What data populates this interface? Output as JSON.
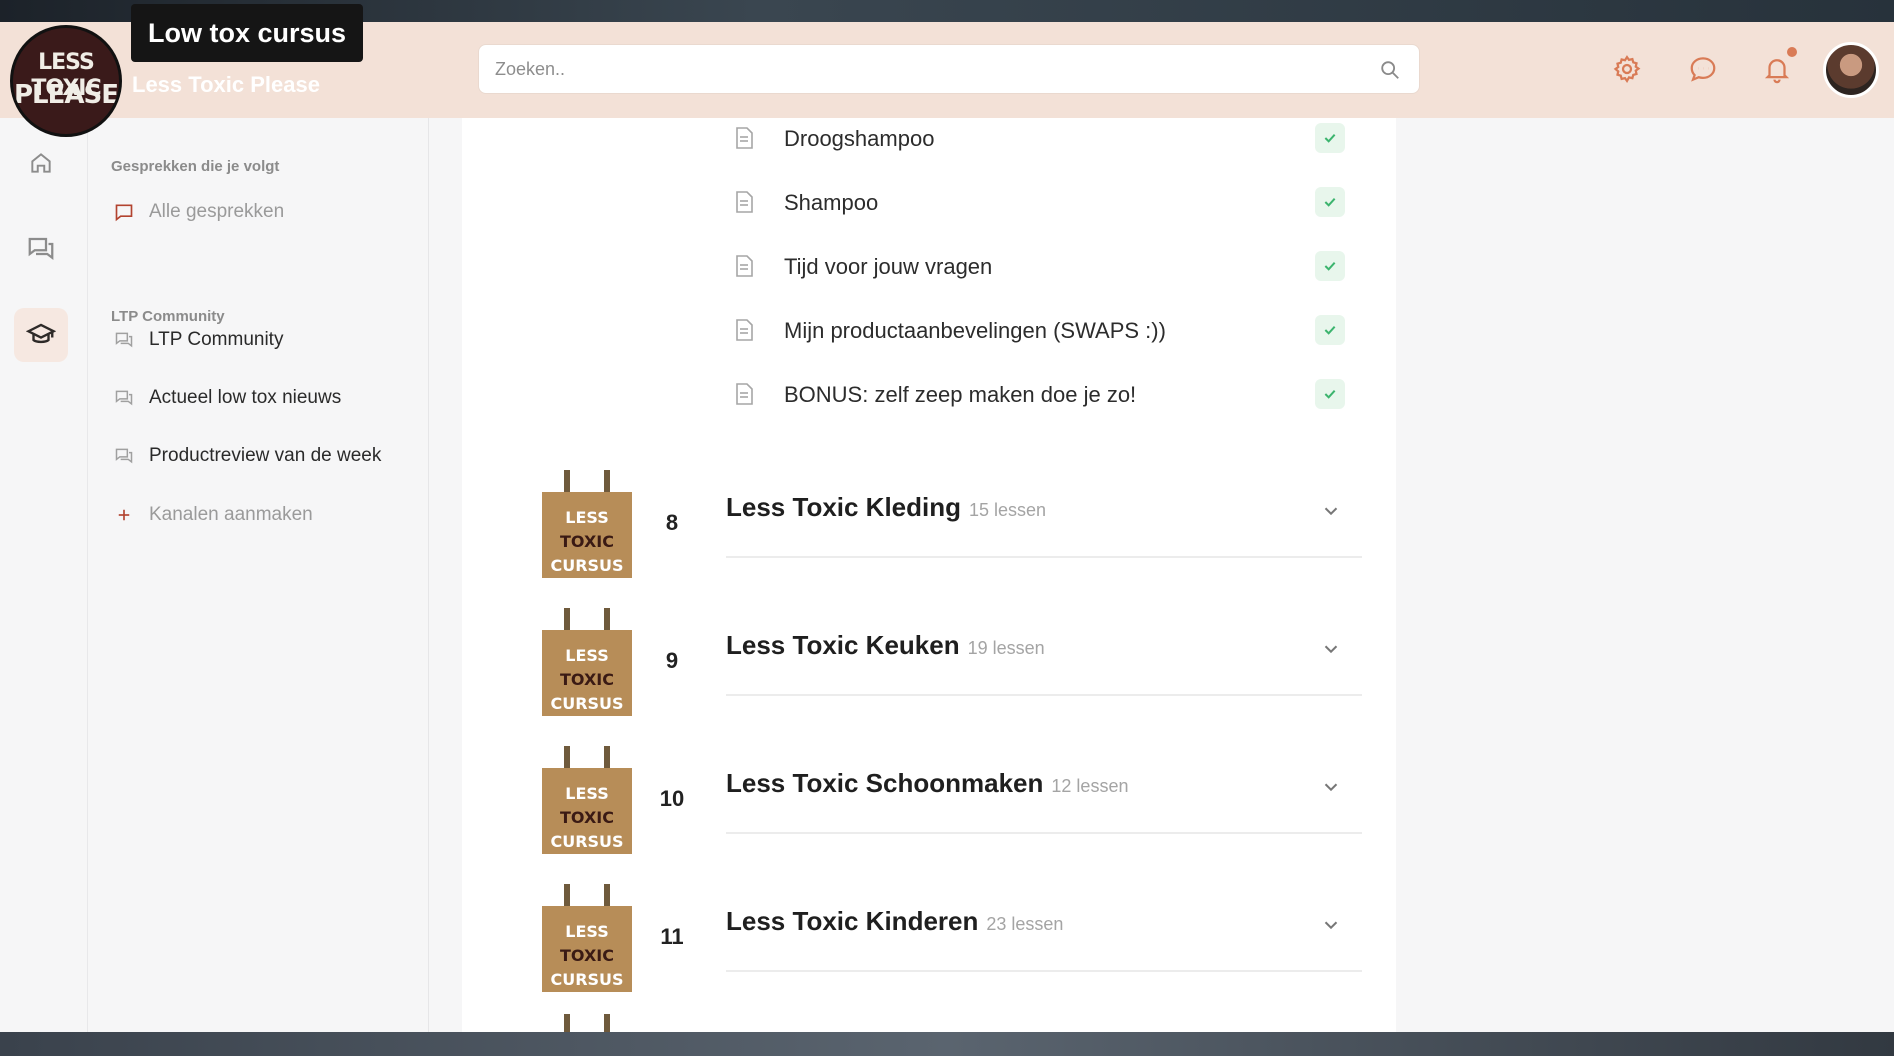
{
  "video": {
    "title": "Low tox cursus"
  },
  "brand": {
    "name": "Less Toxic Please",
    "logo_text_top": "LESS TOXIC",
    "logo_text_bottom": "PLEASE"
  },
  "search": {
    "placeholder": "Zoeken.."
  },
  "header_icons": [
    "gear-icon",
    "chat-bubble-icon",
    "bell-icon"
  ],
  "rail": [
    "home-icon",
    "forum-icon",
    "graduation-cap-icon"
  ],
  "sidebar": {
    "section_followed": "Gesprekken die je volgt",
    "all_conversations": "Alle gesprekken",
    "section_community": "LTP Community",
    "channels": [
      "LTP Community",
      "Actueel low tox nieuws",
      "Productreview van de week"
    ],
    "create_channel": "Kanalen aanmaken"
  },
  "lessons": [
    {
      "title": "Droogshampoo",
      "completed": true
    },
    {
      "title": "Shampoo",
      "completed": true
    },
    {
      "title": "Tijd voor jouw vragen",
      "completed": true
    },
    {
      "title": "Mijn productaanbevelingen (SWAPS :))",
      "completed": true
    },
    {
      "title": "BONUS: zelf zeep maken doe je zo!",
      "completed": true
    }
  ],
  "bag_label": {
    "line1": "LESS",
    "line2": "TOXIC",
    "line3": "CURSUS"
  },
  "modules": [
    {
      "number": "8",
      "title": "Less Toxic Kleding",
      "count": "15 lessen"
    },
    {
      "number": "9",
      "title": "Less Toxic Keuken",
      "count": "19 lessen"
    },
    {
      "number": "10",
      "title": "Less Toxic Schoonmaken",
      "count": "12 lessen"
    },
    {
      "number": "11",
      "title": "Less Toxic Kinderen",
      "count": "23 lessen"
    }
  ],
  "colors": {
    "accent": "#d97b56",
    "header_bg": "#f3e1d7",
    "check_green": "#3cb46e"
  }
}
